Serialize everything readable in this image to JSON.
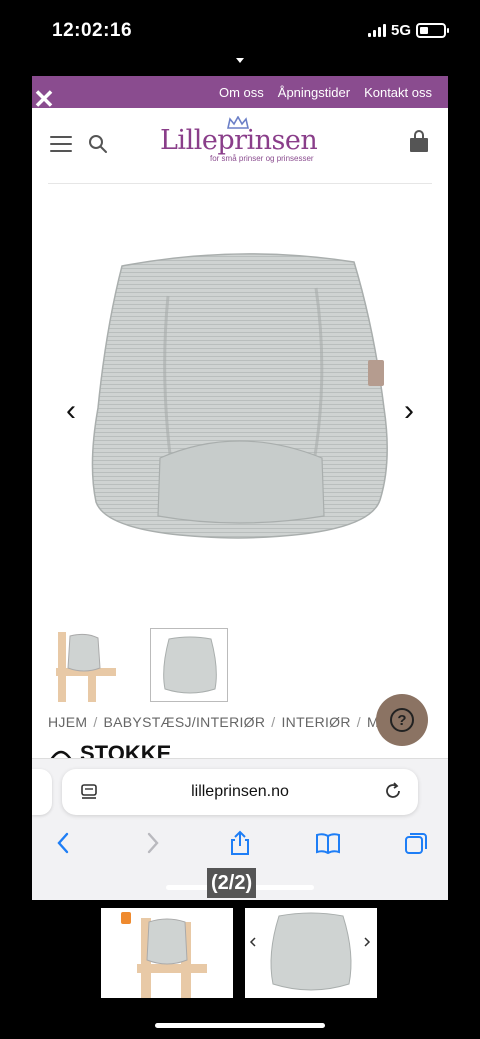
{
  "status": {
    "time": "12:02:16",
    "network": "5G",
    "battery_level": 0.35
  },
  "site": {
    "top_links": [
      "Om oss",
      "Åpningstider",
      "Kontakt oss"
    ],
    "logo_title": "Lilleprinsen",
    "logo_tagline": "for små prinser og prinsesser"
  },
  "product": {
    "breadcrumb": [
      "HJEM",
      "BABYSTÆSJ/INTERIØR",
      "INTERIØR",
      "M"
    ],
    "brand": "STOKKE"
  },
  "browser": {
    "url": "lilleprinsen.no"
  },
  "viewer": {
    "counter": "(2/2)"
  },
  "icons": {
    "close": "close-icon",
    "menu": "menu-icon",
    "search": "search-icon",
    "cart": "shopping-bag-icon",
    "prev": "chevron-left-icon",
    "next": "chevron-right-icon",
    "help": "question-icon",
    "reader": "reader-icon",
    "reload": "reload-icon",
    "share": "share-icon",
    "bookmarks": "book-icon",
    "tabs": "tabs-icon"
  },
  "colors": {
    "topbar": "#8a4c8f",
    "help_button": "#8b7363",
    "safari_blue": "#1e7ef6"
  }
}
